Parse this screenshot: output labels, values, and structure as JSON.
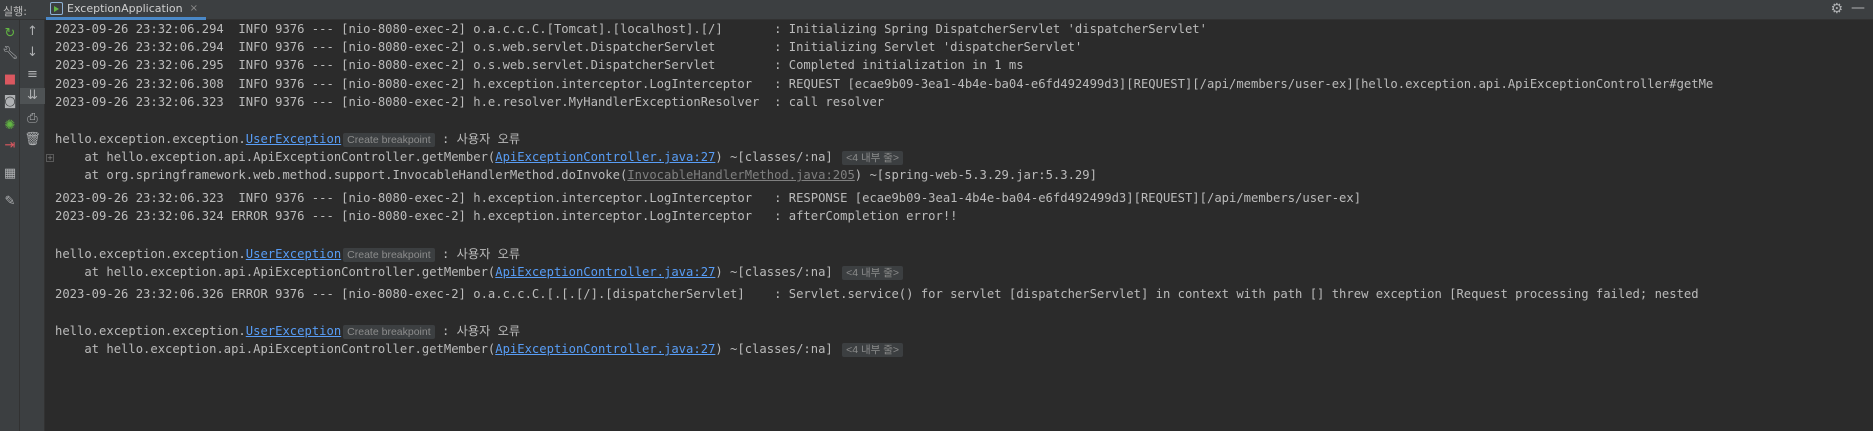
{
  "topbar": {
    "run_label": "실행:",
    "tab_label": "ExceptionApplication",
    "tab_close": "×"
  },
  "toolbar_left": {
    "icons": [
      "rerun-icon",
      "settings-wrench-icon",
      "stop-icon",
      "camera-icon",
      "debug-icon",
      "exit-icon",
      "layout-icon",
      "pin-icon"
    ]
  },
  "toolbar_2": {
    "icons": [
      "arrow-up-icon",
      "arrow-down-icon",
      "soft-wrap-icon",
      "scroll-to-end-icon",
      "print-icon",
      "trash-icon"
    ]
  },
  "log": {
    "l1": "2023-09-26 23:32:06.294  INFO 9376 --- [nio-8080-exec-2] o.a.c.c.C.[Tomcat].[localhost].[/]       : Initializing Spring DispatcherServlet 'dispatcherServlet'",
    "l2": "2023-09-26 23:32:06.294  INFO 9376 --- [nio-8080-exec-2] o.s.web.servlet.DispatcherServlet        : Initializing Servlet 'dispatcherServlet'",
    "l3": "2023-09-26 23:32:06.295  INFO 9376 --- [nio-8080-exec-2] o.s.web.servlet.DispatcherServlet        : Completed initialization in 1 ms",
    "l4": "2023-09-26 23:32:06.308  INFO 9376 --- [nio-8080-exec-2] h.exception.interceptor.LogInterceptor   : REQUEST [ecae9b09-3ea1-4b4e-ba04-e6fd492499d3][REQUEST][/api/members/user-ex][hello.exception.api.ApiExceptionController#getMe",
    "l5": "2023-09-26 23:32:06.323  INFO 9376 --- [nio-8080-exec-2] h.e.resolver.MyHandlerExceptionResolver  : call resolver",
    "exc_prefix": "hello.exception.exception.",
    "exc_class": "UserException",
    "create_breakpoint": "Create breakpoint",
    "exc_message": " : 사용자 오류",
    "at_get_member": "    at hello.exception.api.ApiExceptionController.getMember(",
    "api_controller_link": "ApiExceptionController.java:27",
    "classes_suffix": ") ~[classes/:na] ",
    "internal_lines": "<4 내부 줄>",
    "at_invoke": "    at org.springframework.web.method.support.InvocableHandlerMethod.doInvoke(",
    "invocable_link": "InvocableHandlerMethod.java:205",
    "spring_suffix": ") ~[spring-web-5.3.29.jar:5.3.29]",
    "l6": "2023-09-26 23:32:06.323  INFO 9376 --- [nio-8080-exec-2] h.exception.interceptor.LogInterceptor   : RESPONSE [ecae9b09-3ea1-4b4e-ba04-e6fd492499d3][REQUEST][/api/members/user-ex]",
    "l7": "2023-09-26 23:32:06.324 ERROR 9376 --- [nio-8080-exec-2] h.exception.interceptor.LogInterceptor   : afterCompletion error!!",
    "l8": "2023-09-26 23:32:06.326 ERROR 9376 --- [nio-8080-exec-2] o.a.c.c.C.[.[.[/].[dispatcherServlet]    : Servlet.service() for servlet [dispatcherServlet] in context with path [] threw exception [Request processing failed; nested"
  }
}
